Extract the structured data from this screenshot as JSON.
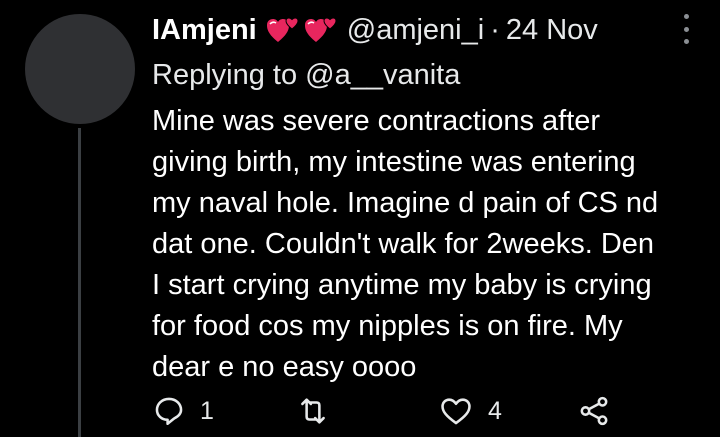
{
  "tweet": {
    "display_name": "IAmjeni",
    "emojis": [
      "revolving-hearts-icon",
      "revolving-hearts-icon"
    ],
    "handle": "@amjeni_i",
    "separator": "·",
    "date": "24 Nov",
    "replying_prefix": "Replying to",
    "replying_to": "@a__vanita",
    "text": "Mine was severe contractions after\ngiving birth, my intestine was entering\nmy naval hole. Imagine d pain of CS nd\ndat one. Couldn't walk for 2weeks. Den\nI start crying anytime my baby is crying\nfor food cos my nipples is on fire. My\ndear e no easy oooo"
  },
  "actions": {
    "reply_count": "1",
    "retweet_count": "",
    "like_count": "4"
  },
  "colors": {
    "background": "#000000",
    "text": "#ffffff",
    "muted": "#e7e9ea",
    "icon": "#8b8f94",
    "emoji": "#e8265e"
  }
}
